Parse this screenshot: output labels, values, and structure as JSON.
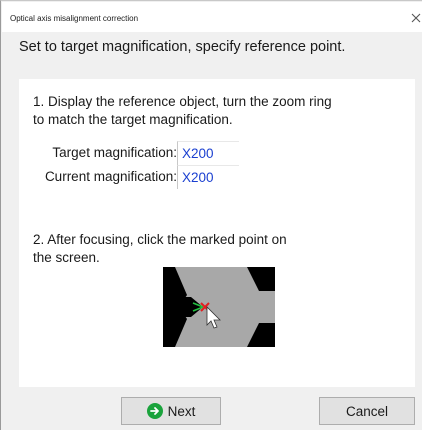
{
  "window": {
    "title": "Optical axis misalignment correction",
    "close_icon": "close-icon"
  },
  "instruction": "Set to target magnification, specify reference point.",
  "step1": {
    "text": "1. Display the reference object, turn the zoom ring to match the target magnification.",
    "target_label": "Target magnification:",
    "target_value": "X200",
    "current_label": "Current magnification:",
    "current_value": "X200"
  },
  "step2": {
    "text": "2. After focusing, click the marked point on the screen.",
    "illustration_icon": "reference-point-illustration"
  },
  "footer": {
    "next_label": "Next",
    "next_icon": "arrow-right-circle-icon",
    "cancel_label": "Cancel"
  },
  "colors": {
    "value_text": "#1a3fd0",
    "next_icon": "#1aa33c",
    "marker": "#e02020",
    "guide_lines": "#22c040"
  }
}
